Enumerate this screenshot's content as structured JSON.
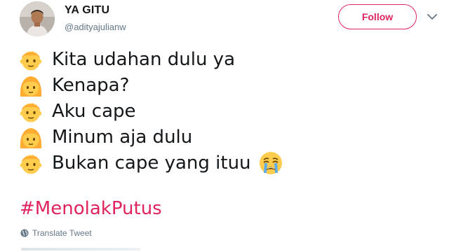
{
  "header": {
    "display_name": "YA GITU",
    "handle": "@adityajulianw",
    "follow_label": "Follow"
  },
  "tweet": {
    "lines": [
      {
        "text": "Kita udahan dulu ya",
        "emoji": "boy-emoji",
        "trailing_emoji": ""
      },
      {
        "text": "Kenapa?",
        "emoji": "girl-emoji",
        "trailing_emoji": ""
      },
      {
        "text": "Aku cape",
        "emoji": "boy-emoji",
        "trailing_emoji": ""
      },
      {
        "text": "Minum aja dulu",
        "emoji": "girl-emoji",
        "trailing_emoji": ""
      },
      {
        "text": "Bukan cape yang ituu",
        "emoji": "boy-emoji",
        "trailing_emoji": "loudly-crying-face-emoji"
      }
    ],
    "hashtag": "#MenolakPutus",
    "translate_label": "Translate Tweet"
  },
  "colors": {
    "accent": "#e0245e",
    "secondary_text": "#657786",
    "primary_text": "#14171a"
  }
}
